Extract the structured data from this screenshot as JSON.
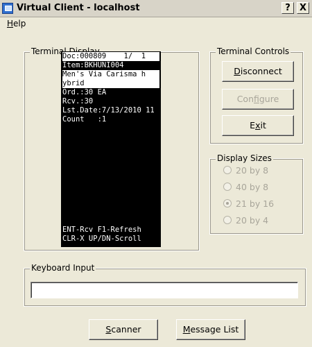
{
  "window": {
    "title": "Virtual Client - localhost",
    "help_button": "?",
    "close_button": "X"
  },
  "menu": {
    "help_u": "H",
    "help_rest": "elp"
  },
  "terminal_display": {
    "legend": "Terminal Display",
    "lines": [
      "Doc:000809    1/  1",
      "Item:BKHUNI004",
      "Men's Via Carisma h",
      "ybrid",
      "Ord.:30 EA",
      "Rcv.:30",
      "Lst.Date:7/13/2010 11",
      "Count   :1"
    ],
    "footer": [
      "ENT-Rcv F1-Refresh",
      "CLR-X UP/DN-Scroll"
    ]
  },
  "terminal_controls": {
    "legend": "Terminal Controls",
    "disconnect_u": "D",
    "disconnect_rest": "isconnect",
    "configure_pre": "Con",
    "configure_u": "f",
    "configure_post": "igure",
    "exit_pre": "E",
    "exit_u": "x",
    "exit_post": "it"
  },
  "display_sizes": {
    "legend": "Display Sizes",
    "options": [
      {
        "label": "20 by 8",
        "checked": false
      },
      {
        "label": "40 by 8",
        "checked": false
      },
      {
        "label": "21 by 16",
        "checked": true
      },
      {
        "label": "20 by 4",
        "checked": false
      }
    ]
  },
  "keyboard_input": {
    "legend": "Keyboard Input",
    "value": ""
  },
  "bottom": {
    "scanner_u": "S",
    "scanner_rest": "canner",
    "message_u": "M",
    "message_rest": "essage List"
  }
}
